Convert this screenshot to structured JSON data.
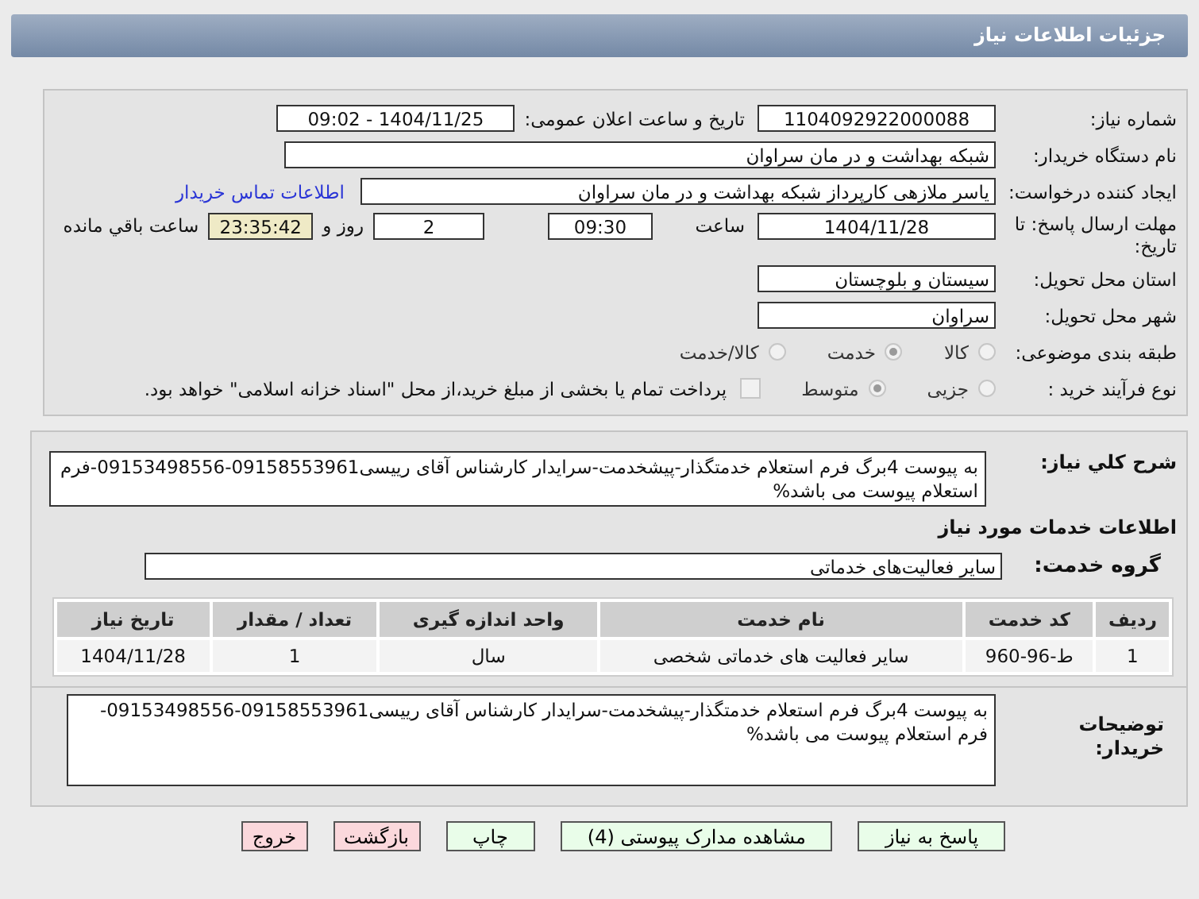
{
  "header": {
    "title": "جزئیات اطلاعات نیاز"
  },
  "info": {
    "need_number": {
      "label": "شماره نیاز:",
      "value": "1104092922000088"
    },
    "announce": {
      "label": "تاریخ و ساعت اعلان عمومی:",
      "value": "1404/11/25 - 09:02"
    },
    "buyer": {
      "label": "نام دستگاه خریدار:",
      "value": "شبکه بهداشت و در مان سراوان"
    },
    "creator": {
      "label": "ایجاد کننده درخواست:",
      "value": "یاسر ملازهی کارپرداز شبکه بهداشت و در مان سراوان",
      "link": "اطلاعات تماس خریدار"
    },
    "deadline": {
      "label": "مهلت ارسال پاسخ: تا تاریخ:",
      "date": "1404/11/28",
      "time_label": "ساعت",
      "time": "09:30",
      "days": "2",
      "days_label": "روز و",
      "remaining": "23:35:42",
      "remaining_label": "ساعت باقي مانده"
    },
    "province": {
      "label": "استان محل تحویل:",
      "value": "سیستان و بلوچستان"
    },
    "city": {
      "label": "شهر محل تحویل:",
      "value": "سراوان"
    },
    "category": {
      "label": "طبقه بندی موضوعی:",
      "options": [
        {
          "label": "کالا",
          "selected": false
        },
        {
          "label": "خدمت",
          "selected": true
        },
        {
          "label": "کالا/خدمت",
          "selected": false
        }
      ]
    },
    "process": {
      "label": "نوع فرآیند خرید :",
      "options": [
        {
          "label": "جزیی",
          "selected": false
        },
        {
          "label": "متوسط",
          "selected": true
        }
      ],
      "treasury": {
        "checked": false,
        "text": "پرداخت تمام یا بخشی از مبلغ خرید،از محل \"اسناد خزانه اسلامی\" خواهد بود."
      }
    }
  },
  "details": {
    "description": {
      "label": "شرح کلي نیاز:",
      "value": "به پیوست 4برگ فرم استعلام خدمتگذار-پیشخدمت-سرایدار کارشناس آقای رییسی09158553961-09153498556-فرم استعلام پیوست می باشد%"
    },
    "section_title": "اطلاعات خدمات مورد نیاز",
    "service_group": {
      "label": "گروه خدمت:",
      "value": "سایر فعالیت‌های خدماتی"
    },
    "table": {
      "columns": [
        "ردیف",
        "کد خدمت",
        "نام خدمت",
        "واحد اندازه گیری",
        "تعداد / مقدار",
        "تاریخ نیاز"
      ],
      "rows": [
        [
          "1",
          "ط-96-960",
          "سایر فعالیت های خدماتی شخصی",
          "سال",
          "1",
          "1404/11/28"
        ]
      ]
    },
    "buyer_notes": {
      "label": "توضیحات خریدار:",
      "value": "به پیوست 4برگ فرم استعلام خدمتگذار-پیشخدمت-سرایدار کارشناس آقای رییسی09158553961-09153498556-فرم استعلام پیوست می باشد%"
    }
  },
  "buttons": [
    {
      "label": "پاسخ به نیاز",
      "kind": "normal"
    },
    {
      "label": "مشاهده مدارک پیوستی (4)",
      "kind": "normal"
    },
    {
      "label": "چاپ",
      "kind": "normal"
    },
    {
      "label": "بازگشت",
      "kind": "exit"
    },
    {
      "label": "خروج",
      "kind": "exit"
    }
  ]
}
